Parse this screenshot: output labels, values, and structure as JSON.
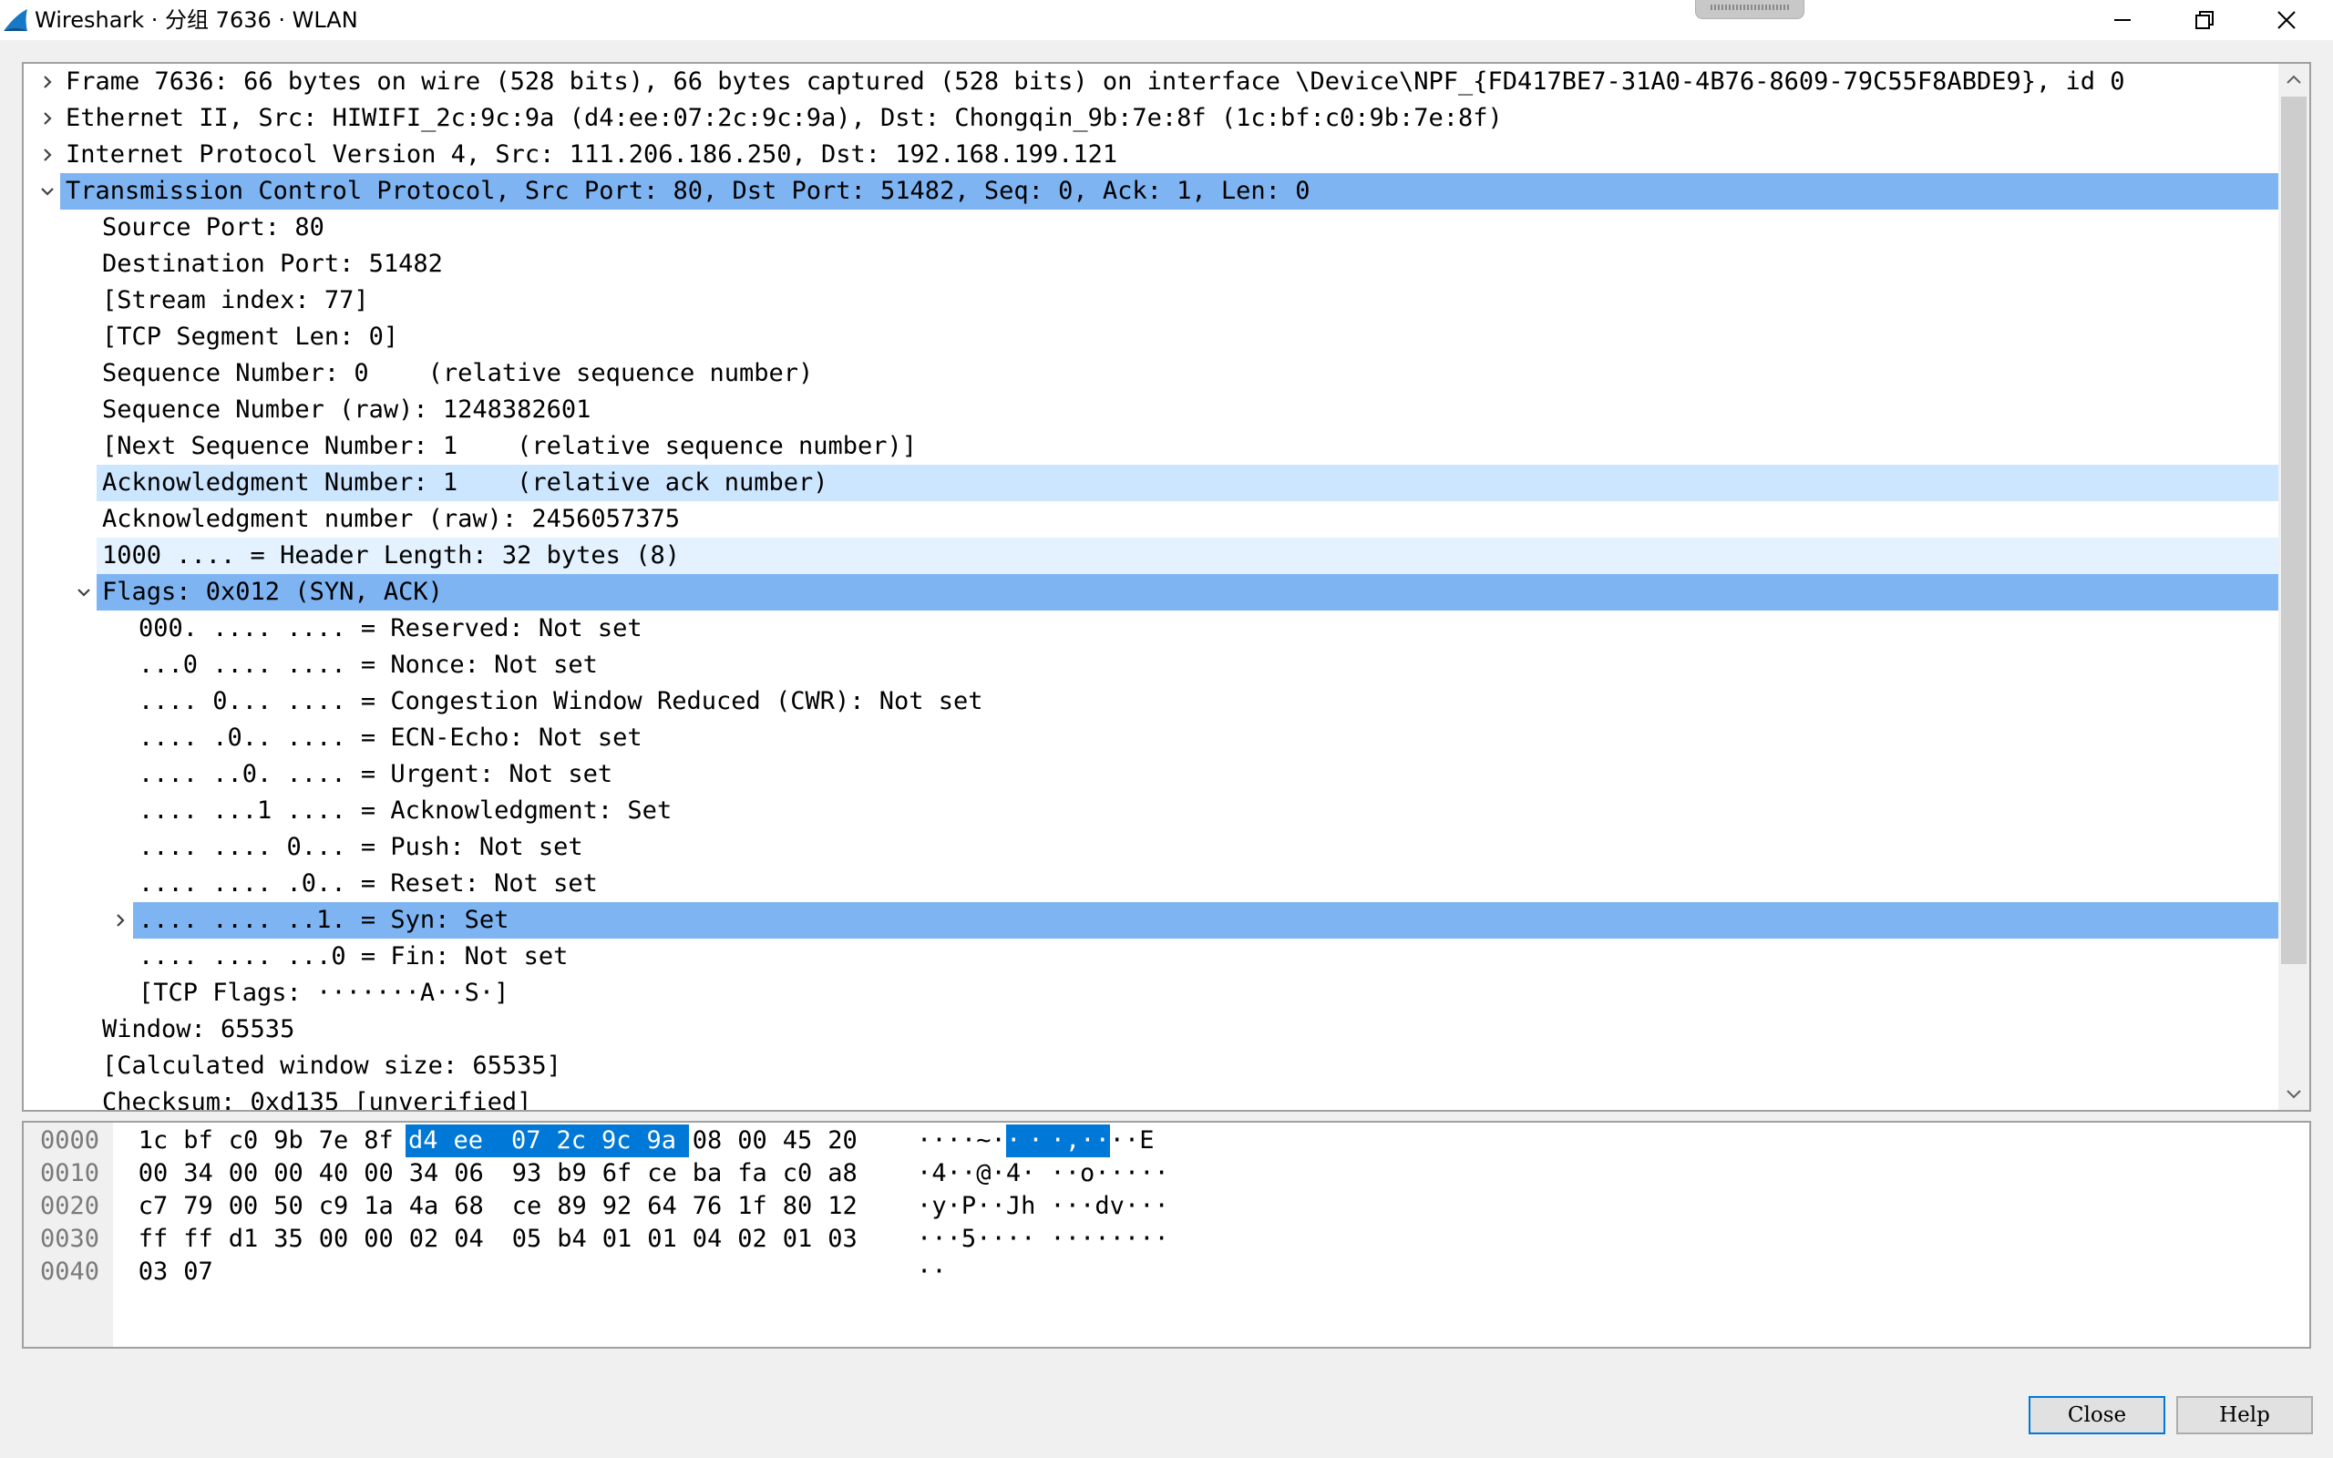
{
  "window": {
    "title": "Wireshark · 分组 7636 · WLAN",
    "controls": [
      "minimize-icon",
      "maximize-icon",
      "close-icon"
    ]
  },
  "details": {
    "rows": [
      {
        "text": "Frame 7636: 66 bytes on wire (528 bits), 66 bytes captured (528 bits) on interface \\Device\\NPF_{FD417BE7-31A0-4B76-8609-79C55F8ABDE9}, id 0",
        "indent": 0,
        "arrow": "collapsed",
        "state": ""
      },
      {
        "text": "Ethernet II, Src: HIWIFI_2c:9c:9a (d4:ee:07:2c:9c:9a), Dst: Chongqin_9b:7e:8f (1c:bf:c0:9b:7e:8f)",
        "indent": 0,
        "arrow": "collapsed",
        "state": ""
      },
      {
        "text": "Internet Protocol Version 4, Src: 111.206.186.250, Dst: 192.168.199.121",
        "indent": 0,
        "arrow": "collapsed",
        "state": ""
      },
      {
        "text": "Transmission Control Protocol, Src Port: 80, Dst Port: 51482, Seq: 0, Ack: 1, Len: 0",
        "indent": 0,
        "arrow": "expanded",
        "state": "sel"
      },
      {
        "text": "Source Port: 80",
        "indent": 1,
        "arrow": "",
        "state": ""
      },
      {
        "text": "Destination Port: 51482",
        "indent": 1,
        "arrow": "",
        "state": ""
      },
      {
        "text": "[Stream index: 77]",
        "indent": 1,
        "arrow": "",
        "state": ""
      },
      {
        "text": "[TCP Segment Len: 0]",
        "indent": 1,
        "arrow": "",
        "state": ""
      },
      {
        "text": "Sequence Number: 0    (relative sequence number)",
        "indent": 1,
        "arrow": "",
        "state": ""
      },
      {
        "text": "Sequence Number (raw): 1248382601",
        "indent": 1,
        "arrow": "",
        "state": ""
      },
      {
        "text": "[Next Sequence Number: 1    (relative sequence number)]",
        "indent": 1,
        "arrow": "",
        "state": ""
      },
      {
        "text": "Acknowledgment Number: 1    (relative ack number)",
        "indent": 1,
        "arrow": "",
        "state": "soft"
      },
      {
        "text": "Acknowledgment number (raw): 2456057375",
        "indent": 1,
        "arrow": "",
        "state": ""
      },
      {
        "text": "1000 .... = Header Length: 32 bytes (8)",
        "indent": 1,
        "arrow": "",
        "state": "pale"
      },
      {
        "text": "Flags: 0x012 (SYN, ACK)",
        "indent": 1,
        "arrow": "expanded",
        "state": "sel"
      },
      {
        "text": "000. .... .... = Reserved: Not set",
        "indent": 2,
        "arrow": "",
        "state": ""
      },
      {
        "text": "...0 .... .... = Nonce: Not set",
        "indent": 2,
        "arrow": "",
        "state": ""
      },
      {
        "text": ".... 0... .... = Congestion Window Reduced (CWR): Not set",
        "indent": 2,
        "arrow": "",
        "state": ""
      },
      {
        "text": ".... .0.. .... = ECN-Echo: Not set",
        "indent": 2,
        "arrow": "",
        "state": ""
      },
      {
        "text": ".... ..0. .... = Urgent: Not set",
        "indent": 2,
        "arrow": "",
        "state": ""
      },
      {
        "text": ".... ...1 .... = Acknowledgment: Set",
        "indent": 2,
        "arrow": "",
        "state": ""
      },
      {
        "text": ".... .... 0... = Push: Not set",
        "indent": 2,
        "arrow": "",
        "state": ""
      },
      {
        "text": ".... .... .0.. = Reset: Not set",
        "indent": 2,
        "arrow": "",
        "state": ""
      },
      {
        "text": ".... .... ..1. = Syn: Set",
        "indent": 2,
        "arrow": "collapsed",
        "state": "sel"
      },
      {
        "text": ".... .... ...0 = Fin: Not set",
        "indent": 2,
        "arrow": "",
        "state": ""
      },
      {
        "text": "[TCP Flags: ·······A··S·]",
        "indent": 2,
        "arrow": "",
        "state": ""
      },
      {
        "text": "Window: 65535",
        "indent": 1,
        "arrow": "",
        "state": ""
      },
      {
        "text": "[Calculated window size: 65535]",
        "indent": 1,
        "arrow": "",
        "state": ""
      },
      {
        "text": "Checksum: 0xd135 [unverified]",
        "indent": 1,
        "arrow": "",
        "state": ""
      }
    ]
  },
  "bytes": {
    "rows": [
      {
        "offset": "0000",
        "hex": [
          "1c",
          "bf",
          "c0",
          "9b",
          "7e",
          "8f",
          "d4",
          "ee",
          "07",
          "2c",
          "9c",
          "9a",
          "08",
          "00",
          "45",
          "20"
        ],
        "ascii": [
          "·",
          "·",
          "·",
          "·",
          "~",
          "·",
          "·",
          "·",
          "·",
          ",",
          "·",
          "·",
          "·",
          "·",
          "E",
          " "
        ]
      },
      {
        "offset": "0010",
        "hex": [
          "00",
          "34",
          "00",
          "00",
          "40",
          "00",
          "34",
          "06",
          "93",
          "b9",
          "6f",
          "ce",
          "ba",
          "fa",
          "c0",
          "a8"
        ],
        "ascii": [
          "·",
          "4",
          "·",
          "·",
          "@",
          "·",
          "4",
          "·",
          "·",
          "·",
          "o",
          "·",
          "·",
          "·",
          "·",
          "·"
        ]
      },
      {
        "offset": "0020",
        "hex": [
          "c7",
          "79",
          "00",
          "50",
          "c9",
          "1a",
          "4a",
          "68",
          "ce",
          "89",
          "92",
          "64",
          "76",
          "1f",
          "80",
          "12"
        ],
        "ascii": [
          "·",
          "y",
          "·",
          "P",
          "·",
          "·",
          "J",
          "h",
          "·",
          "·",
          "·",
          "d",
          "v",
          "·",
          "·",
          "·"
        ]
      },
      {
        "offset": "0030",
        "hex": [
          "ff",
          "ff",
          "d1",
          "35",
          "00",
          "00",
          "02",
          "04",
          "05",
          "b4",
          "01",
          "01",
          "04",
          "02",
          "01",
          "03"
        ],
        "ascii": [
          "·",
          "·",
          "·",
          "5",
          "·",
          "·",
          "·",
          "·",
          "·",
          "·",
          "·",
          "·",
          "·",
          "·",
          "·",
          "·"
        ]
      },
      {
        "offset": "0040",
        "hex": [
          "03",
          "07"
        ],
        "ascii": [
          "·",
          "·"
        ]
      }
    ],
    "highlight_start": 6,
    "highlight_end": 11
  },
  "buttons": {
    "close_label": "Close",
    "help_label": "Help"
  },
  "colors": {
    "selected_row": "#7eb4f2",
    "related_row": "#cde6ff",
    "byte_highlight": "#0078d7",
    "offset_text": "#7a7a7a"
  }
}
